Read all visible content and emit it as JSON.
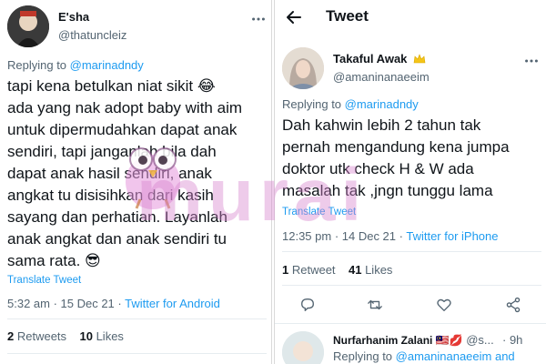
{
  "left_tweet": {
    "display_name": "E'sha",
    "handle": "@thatuncleiz",
    "replying_prefix": "Replying to ",
    "replying_to": "@marinadndy",
    "lines": [
      "tapi kena betulkan niat sikit 😂",
      "ada yang nak adopt baby with aim",
      "untuk dipermudahkan dapat anak",
      "sendiri, tapi janganlah bila dah",
      "dapat anak hasil sendiri, anak",
      "angkat tu disisihkan dari kasih",
      "sayang dan perhatian. Layanlah",
      "anak angkat dan anak sendiri tu",
      "sama rata. 😎"
    ],
    "translate_label": "Translate Tweet",
    "timestamp": "5:32 am · 15 Dec 21 · ",
    "source": "Twitter for Android",
    "retweets_count": "2",
    "retweets_label": " Retweets",
    "likes_count": "10",
    "likes_label": " Likes"
  },
  "right_header": {
    "title": "Tweet"
  },
  "right_tweet": {
    "display_name": "Takaful Awak",
    "handle": "@amaninanaeeim",
    "replying_prefix": "Replying to ",
    "replying_to": "@marinadndy",
    "lines": [
      "Dah kahwin lebih 2 tahun tak",
      "pernah mengandung kena jumpa",
      "doktor utk check H & W ada",
      "masalah tak ,jngn tunggu lama"
    ],
    "translate_label": "Translate Tweet",
    "timestamp": "12:35 pm · 14 Dec 21 · ",
    "source": "Twitter for iPhone",
    "retweets_count": "1",
    "retweets_label": " Retweet",
    "likes_count": "41",
    "likes_label": " Likes"
  },
  "next_reply": {
    "display_name": "Nurfarhanim Zalani 🇲🇾💋",
    "handle": " @s...",
    "time": "· 9h",
    "replying_prefix": "Replying to ",
    "replying_to": "@amaninanaeeim and"
  },
  "watermark": {
    "text": "murai"
  },
  "icons": [
    "back-arrow-icon",
    "more-dots-icon",
    "verified-crown-icon",
    "reply-icon",
    "retweet-icon",
    "like-icon",
    "share-icon"
  ],
  "colors": {
    "link": "#1d9bf0",
    "secondary_text": "#536471",
    "primary_text": "#0f1419",
    "watermark": "#d684ce"
  }
}
